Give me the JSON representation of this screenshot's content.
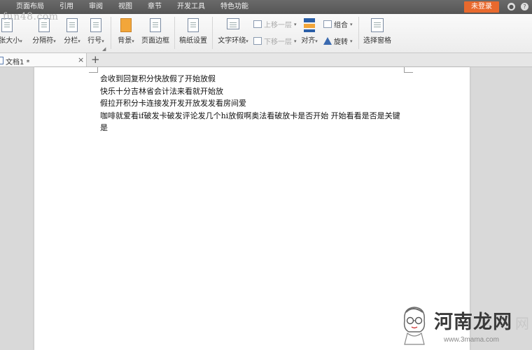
{
  "menu": {
    "tabs": [
      {
        "label": "页面布局",
        "active": true
      },
      {
        "label": "引用",
        "active": false
      },
      {
        "label": "审阅",
        "active": false
      },
      {
        "label": "视图",
        "active": false
      },
      {
        "label": "章节",
        "active": false
      },
      {
        "label": "开发工具",
        "active": false
      },
      {
        "label": "特色功能",
        "active": false
      }
    ],
    "login_label": "未登录"
  },
  "ribbon": {
    "paper_size": "纸张大小",
    "separator": "分隔符",
    "columns": "分栏",
    "line_number": "行号",
    "background": "背景",
    "page_border": "页面边框",
    "manuscript_settings": "稿纸设置",
    "text_wrap": "文字环绕",
    "bring_forward": "上移一层",
    "send_backward": "下移一层",
    "align": "对齐",
    "group": "组合",
    "rotate": "旋转",
    "selection_pane": "选择窗格",
    "dropdown_caret": "▾"
  },
  "doc_tabs": {
    "title": "文档1 *",
    "close": "×",
    "new": "+"
  },
  "document": {
    "lines": [
      "会收到回复积分快放假了开始放假",
      "快乐十分吉林省会计法来看就开始放",
      "假拉开积分卡连接发开发开放发发看房间爱",
      "咖啡就爱看if破发卡破发评论发几个hi放假啊奥法看破放卡是否开始  开始看看是否是关键",
      "是"
    ]
  },
  "watermarks": {
    "top_left": "fun48.com",
    "brand": "河南龙网",
    "brand_sub": "网",
    "domain": "www.3mama.com"
  },
  "colors": {
    "menubar": "#5e5e5e",
    "login_button": "#e8692d",
    "ribbon_bg": "#f2f2f2",
    "workspace_bg": "#d9d9d9",
    "page_bg": "#ffffff"
  }
}
